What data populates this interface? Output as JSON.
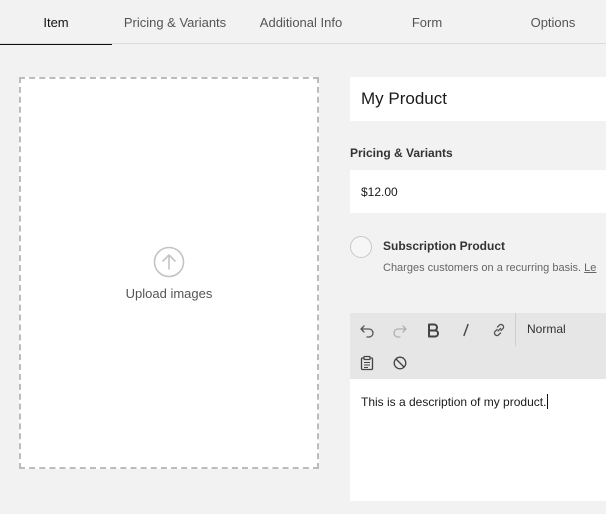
{
  "tabs": [
    {
      "label": "Item",
      "active": true
    },
    {
      "label": "Pricing & Variants",
      "active": false
    },
    {
      "label": "Additional Info",
      "active": false
    },
    {
      "label": "Form",
      "active": false
    },
    {
      "label": "Options",
      "active": false
    }
  ],
  "upload": {
    "icon": "upload-arrow-icon",
    "label": "Upload images"
  },
  "product": {
    "title_value": "My Product"
  },
  "pricing": {
    "section_label": "Pricing & Variants",
    "price_value": "$12.00"
  },
  "subscription": {
    "title": "Subscription Product",
    "description": "Charges customers on a recurring basis. ",
    "link_text": "Le",
    "checked": false
  },
  "editor": {
    "toolbar": {
      "undo_icon": "undo-icon",
      "redo_icon": "redo-icon",
      "bold_icon": "bold-icon",
      "italic_icon": "italic-icon",
      "link_icon": "link-icon",
      "format_label": "Normal",
      "paste_icon": "clipboard-icon",
      "clear_icon": "clear-formatting-icon"
    },
    "content": "This is a description of my product."
  },
  "colors": {
    "background": "#f2f2f2",
    "field": "#ffffff",
    "toolbar": "#e6e6e6",
    "upload_border": "#bcbcbc"
  }
}
